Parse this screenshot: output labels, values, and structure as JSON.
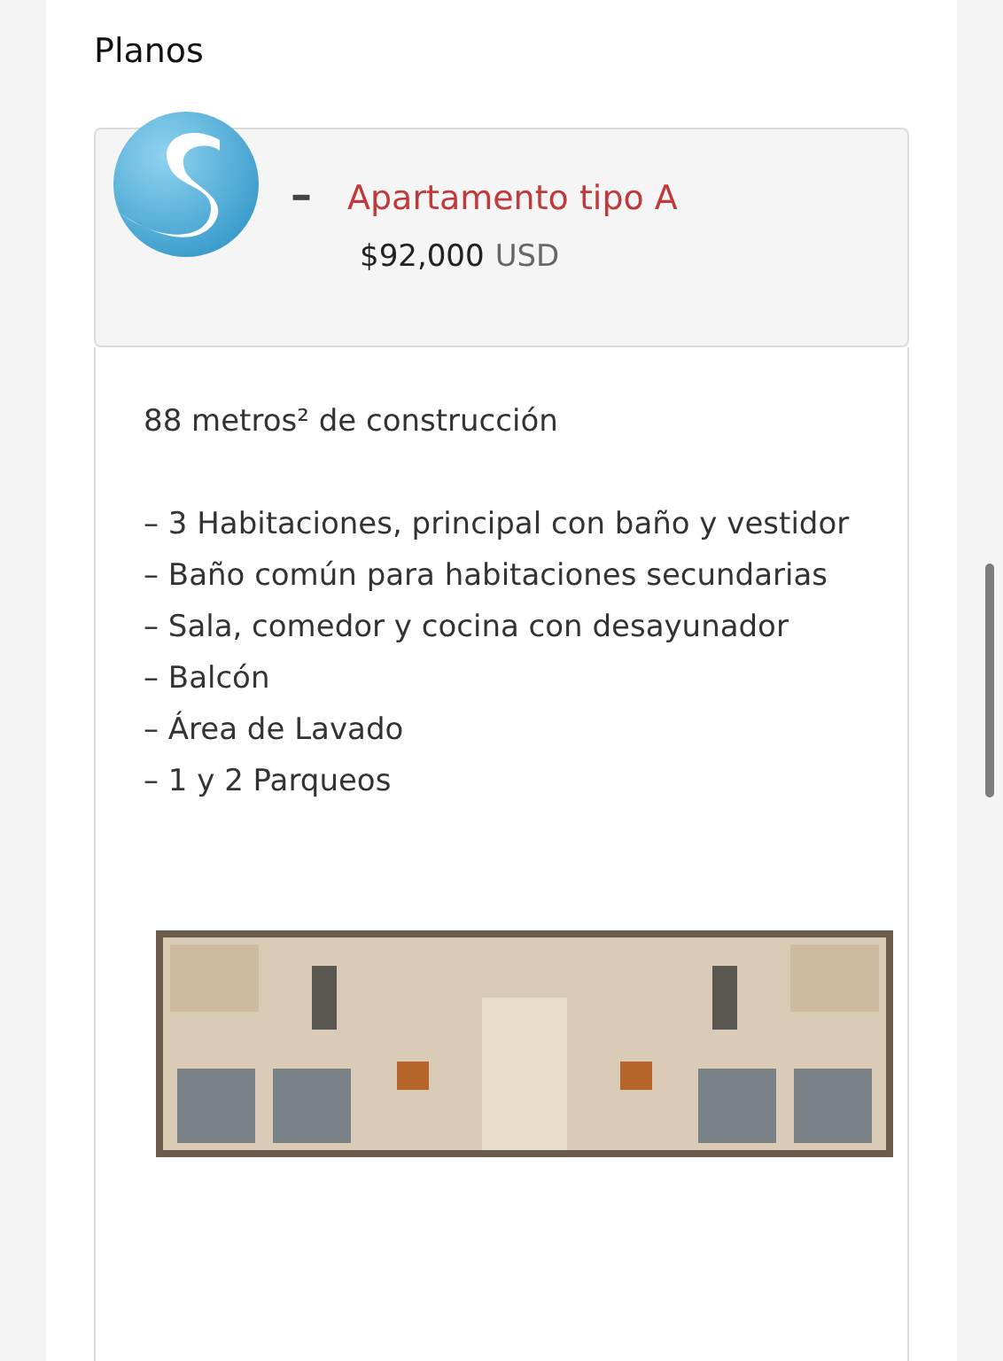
{
  "section_title": "Planos",
  "plan": {
    "separator": "–",
    "title": "Apartamento tipo A",
    "price": "$92,000",
    "currency": "USD",
    "area": "88 metros² de construcción",
    "features": [
      "– 3 Habitaciones, principal con baño y vestidor",
      "– Baño común para habitaciones secundarias",
      "– Sala, comedor y cocina con desayunador",
      "– Balcón",
      "– Área de Lavado",
      "– 1 y 2 Parqueos"
    ]
  }
}
